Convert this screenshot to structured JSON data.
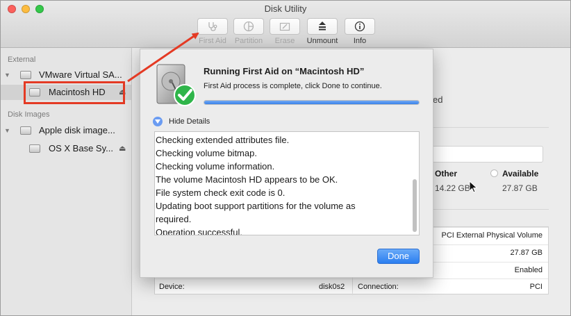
{
  "window": {
    "title": "Disk Utility"
  },
  "toolbar": {
    "first_aid": "First Aid",
    "partition": "Partition",
    "erase": "Erase",
    "unmount": "Unmount",
    "info": "Info"
  },
  "sidebar": {
    "external_header": "External",
    "disk_images_header": "Disk Images",
    "items": [
      {
        "label": "VMware Virtual SA..."
      },
      {
        "label": "Macintosh HD"
      },
      {
        "label": "Apple disk image..."
      },
      {
        "label": "OS X Base Sy..."
      }
    ]
  },
  "background": {
    "partial_text": "ed",
    "other_label": "Other",
    "other_value": "14.22 GB",
    "available_label": "Available",
    "available_value": "27.87 GB",
    "info_rows": [
      {
        "right_value": "PCI External Physical Volume"
      },
      {
        "right_value": "27.87 GB"
      },
      {
        "right_value": "Enabled"
      },
      {
        "left_label": "Device:",
        "left_value": "disk0s2",
        "right_label": "Connection:",
        "right_value": "PCI"
      }
    ]
  },
  "sheet": {
    "title": "Running First Aid on “Macintosh HD”",
    "subtitle": "First Aid process is complete, click Done to continue.",
    "progress_fraction": 1.0,
    "details_toggle": "Hide Details",
    "log_lines": [
      "Checking extended attributes file.",
      "Checking volume bitmap.",
      "Checking volume information.",
      "The volume Macintosh HD appears to be OK.",
      "File system check exit code is 0.",
      "Updating boot support partitions for the volume as",
      "required.",
      "Operation successful."
    ],
    "done_button": "Done"
  },
  "colors": {
    "annotation_red": "#e43a24",
    "accent_blue": "#3b82e8",
    "check_green": "#2fb54a"
  }
}
